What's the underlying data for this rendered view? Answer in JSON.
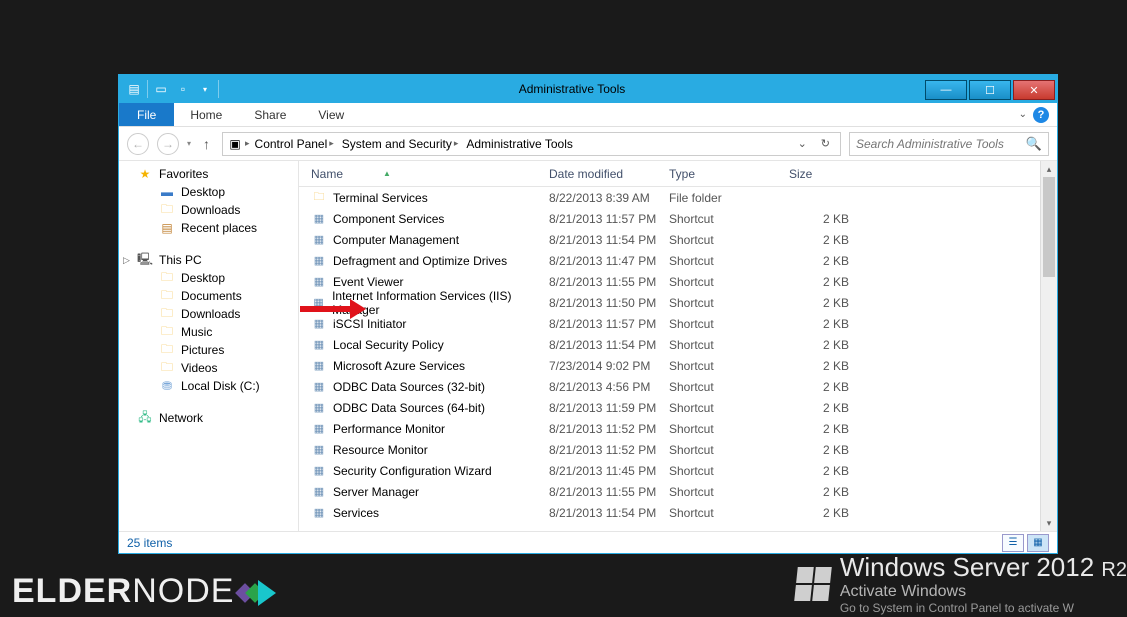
{
  "title": "Administrative Tools",
  "ribbon": {
    "file": "File",
    "tabs": [
      "Home",
      "Share",
      "View"
    ]
  },
  "breadcrumbs": [
    "Control Panel",
    "System and Security",
    "Administrative Tools"
  ],
  "search": {
    "placeholder": "Search Administrative Tools"
  },
  "columns": {
    "name": "Name",
    "date": "Date modified",
    "type": "Type",
    "size": "Size"
  },
  "sidebar": {
    "favorites": {
      "label": "Favorites",
      "items": [
        "Desktop",
        "Downloads",
        "Recent places"
      ]
    },
    "thispc": {
      "label": "This PC",
      "items": [
        "Desktop",
        "Documents",
        "Downloads",
        "Music",
        "Pictures",
        "Videos",
        "Local Disk (C:)"
      ]
    },
    "network": {
      "label": "Network"
    }
  },
  "rows": [
    {
      "name": "Terminal Services",
      "date": "8/22/2013 8:39 AM",
      "type": "File folder",
      "size": "",
      "icon": "folder"
    },
    {
      "name": "Component Services",
      "date": "8/21/2013 11:57 PM",
      "type": "Shortcut",
      "size": "2 KB",
      "icon": "app"
    },
    {
      "name": "Computer Management",
      "date": "8/21/2013 11:54 PM",
      "type": "Shortcut",
      "size": "2 KB",
      "icon": "app"
    },
    {
      "name": "Defragment and Optimize Drives",
      "date": "8/21/2013 11:47 PM",
      "type": "Shortcut",
      "size": "2 KB",
      "icon": "app"
    },
    {
      "name": "Event Viewer",
      "date": "8/21/2013 11:55 PM",
      "type": "Shortcut",
      "size": "2 KB",
      "icon": "app"
    },
    {
      "name": "Internet Information Services (IIS) Manager",
      "date": "8/21/2013 11:50 PM",
      "type": "Shortcut",
      "size": "2 KB",
      "icon": "app"
    },
    {
      "name": "iSCSI Initiator",
      "date": "8/21/2013 11:57 PM",
      "type": "Shortcut",
      "size": "2 KB",
      "icon": "app"
    },
    {
      "name": "Local Security Policy",
      "date": "8/21/2013 11:54 PM",
      "type": "Shortcut",
      "size": "2 KB",
      "icon": "app"
    },
    {
      "name": "Microsoft Azure Services",
      "date": "7/23/2014 9:02 PM",
      "type": "Shortcut",
      "size": "2 KB",
      "icon": "app"
    },
    {
      "name": "ODBC Data Sources (32-bit)",
      "date": "8/21/2013 4:56 PM",
      "type": "Shortcut",
      "size": "2 KB",
      "icon": "app"
    },
    {
      "name": "ODBC Data Sources (64-bit)",
      "date": "8/21/2013 11:59 PM",
      "type": "Shortcut",
      "size": "2 KB",
      "icon": "app"
    },
    {
      "name": "Performance Monitor",
      "date": "8/21/2013 11:52 PM",
      "type": "Shortcut",
      "size": "2 KB",
      "icon": "app"
    },
    {
      "name": "Resource Monitor",
      "date": "8/21/2013 11:52 PM",
      "type": "Shortcut",
      "size": "2 KB",
      "icon": "app"
    },
    {
      "name": "Security Configuration Wizard",
      "date": "8/21/2013 11:45 PM",
      "type": "Shortcut",
      "size": "2 KB",
      "icon": "app"
    },
    {
      "name": "Server Manager",
      "date": "8/21/2013 11:55 PM",
      "type": "Shortcut",
      "size": "2 KB",
      "icon": "app"
    },
    {
      "name": "Services",
      "date": "8/21/2013 11:54 PM",
      "type": "Shortcut",
      "size": "2 KB",
      "icon": "app"
    }
  ],
  "status": {
    "count": "25 items"
  },
  "watermark": {
    "line1a": "Windows Server 2012",
    "line1b": "R2",
    "line2": "Activate Windows",
    "line3": "Go to System in Control Panel to activate W"
  },
  "brand": {
    "a": "ELDER",
    "b": "NODE"
  }
}
